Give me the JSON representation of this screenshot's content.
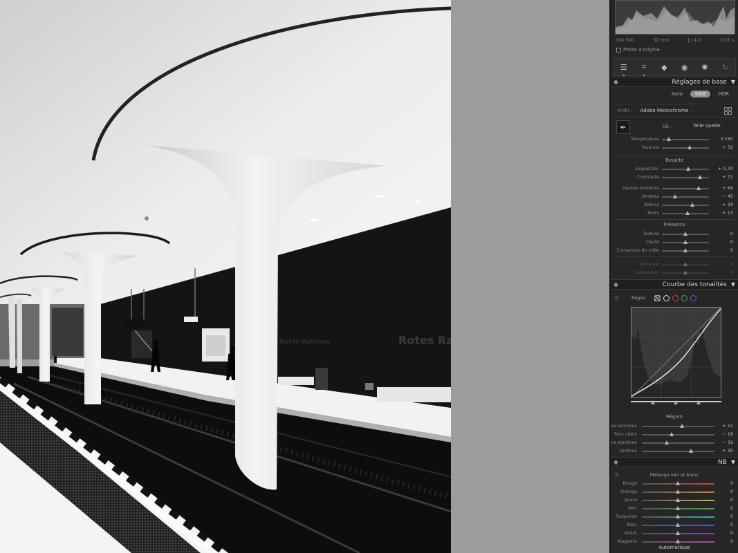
{
  "photo": {
    "sign_text": "Rotes Rath",
    "sign_text_small": "Rotes Rathaus"
  },
  "histogram": {
    "exif": [
      "ISO 500",
      "32 mm",
      "ƒ / 4,0",
      "1/25 s"
    ],
    "original_photo_label": "Photo d'origine"
  },
  "toolstrip": {
    "tools": [
      "edit-sliders-icon",
      "crop-icon",
      "heal-eraser-icon",
      "red-eye-icon",
      "masking-icon",
      "history-icon"
    ]
  },
  "basic": {
    "title": "Réglages de base",
    "modes": [
      "Auto",
      "N&B",
      "HDR"
    ],
    "active_mode": "N&B",
    "profile_label": "Profil :",
    "profile_value": "Adobe Monochrome",
    "wb_label": "BB :",
    "wb_value": "Telle quelle",
    "wb_sliders": [
      {
        "label": "Température",
        "value": "3 150",
        "pos": 0.16
      },
      {
        "label": "Nuance",
        "value": "+ 32",
        "pos": 0.6
      }
    ],
    "tonalite_title": "Tonalité",
    "tone_sliders": [
      {
        "label": "Exposition",
        "value": "+ 0,70",
        "pos": 0.56
      },
      {
        "label": "Contraste",
        "value": "+ 71",
        "pos": 0.82
      }
    ],
    "tone_sliders2": [
      {
        "label": "Hautes lumières",
        "value": "+ 64",
        "pos": 0.79
      },
      {
        "label": "Ombres",
        "value": "− 45",
        "pos": 0.29
      },
      {
        "label": "Blancs",
        "value": "+ 34",
        "pos": 0.66
      },
      {
        "label": "Noirs",
        "value": "+ 13",
        "pos": 0.55
      }
    ],
    "presence_title": "Présence",
    "presence_sliders": [
      {
        "label": "Texture",
        "value": "0",
        "pos": 0.5
      },
      {
        "label": "Clarté",
        "value": "0",
        "pos": 0.5
      },
      {
        "label": "Correction du voile",
        "value": "0",
        "pos": 0.5
      }
    ],
    "color_sliders": [
      {
        "label": "Vibrance",
        "value": "0",
        "pos": 0.5
      },
      {
        "label": "Saturation",
        "value": "0",
        "pos": 0.5
      }
    ]
  },
  "curve": {
    "title": "Courbe des tonalités",
    "adjust_label": "Régler",
    "region_title": "Région",
    "region_sliders": [
      {
        "label": "Hautes lumières",
        "value": "+ 11",
        "pos": 0.56
      },
      {
        "label": "Tons clairs",
        "value": "− 18",
        "pos": 0.41
      },
      {
        "label": "Tons sombres",
        "value": "− 31",
        "pos": 0.35
      },
      {
        "label": "Ombres",
        "value": "+ 35",
        "pos": 0.68
      }
    ]
  },
  "nb": {
    "title": "NB",
    "mix_label": "Mélange noir et blanc",
    "channels": [
      {
        "label": "Rouge",
        "value": "0",
        "pos": 0.5,
        "color": "#d04040"
      },
      {
        "label": "Orange",
        "value": "0",
        "pos": 0.5,
        "color": "#d08030"
      },
      {
        "label": "Jaune",
        "value": "0",
        "pos": 0.5,
        "color": "#c8c030"
      },
      {
        "label": "Vert",
        "value": "0",
        "pos": 0.5,
        "color": "#40b040"
      },
      {
        "label": "Turquoise",
        "value": "0",
        "pos": 0.5,
        "color": "#30b0b0"
      },
      {
        "label": "Bleu",
        "value": "0",
        "pos": 0.5,
        "color": "#4060d0"
      },
      {
        "label": "Violet",
        "value": "0",
        "pos": 0.5,
        "color": "#8040c0"
      },
      {
        "label": "Magenta",
        "value": "0",
        "pos": 0.5,
        "color": "#c040a0"
      }
    ],
    "auto_label": "Automatique"
  }
}
